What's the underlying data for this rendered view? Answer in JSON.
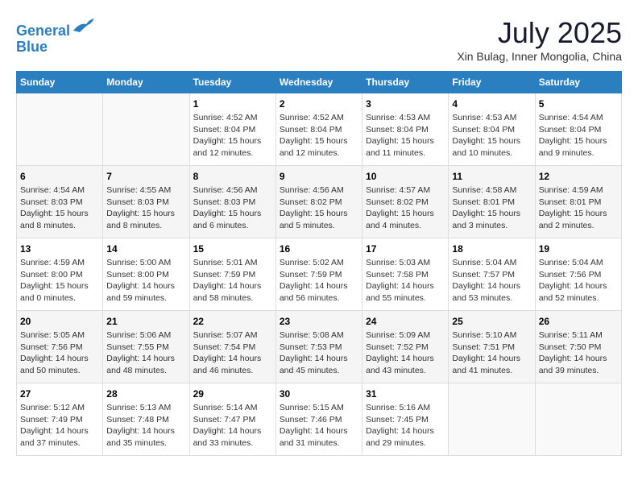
{
  "header": {
    "logo_line1": "General",
    "logo_line2": "Blue",
    "month_title": "July 2025",
    "location": "Xin Bulag, Inner Mongolia, China"
  },
  "weekdays": [
    "Sunday",
    "Monday",
    "Tuesday",
    "Wednesday",
    "Thursday",
    "Friday",
    "Saturday"
  ],
  "weeks": [
    [
      {
        "day": "",
        "sunrise": "",
        "sunset": "",
        "daylight": ""
      },
      {
        "day": "",
        "sunrise": "",
        "sunset": "",
        "daylight": ""
      },
      {
        "day": "1",
        "sunrise": "Sunrise: 4:52 AM",
        "sunset": "Sunset: 8:04 PM",
        "daylight": "Daylight: 15 hours and 12 minutes."
      },
      {
        "day": "2",
        "sunrise": "Sunrise: 4:52 AM",
        "sunset": "Sunset: 8:04 PM",
        "daylight": "Daylight: 15 hours and 12 minutes."
      },
      {
        "day": "3",
        "sunrise": "Sunrise: 4:53 AM",
        "sunset": "Sunset: 8:04 PM",
        "daylight": "Daylight: 15 hours and 11 minutes."
      },
      {
        "day": "4",
        "sunrise": "Sunrise: 4:53 AM",
        "sunset": "Sunset: 8:04 PM",
        "daylight": "Daylight: 15 hours and 10 minutes."
      },
      {
        "day": "5",
        "sunrise": "Sunrise: 4:54 AM",
        "sunset": "Sunset: 8:04 PM",
        "daylight": "Daylight: 15 hours and 9 minutes."
      }
    ],
    [
      {
        "day": "6",
        "sunrise": "Sunrise: 4:54 AM",
        "sunset": "Sunset: 8:03 PM",
        "daylight": "Daylight: 15 hours and 8 minutes."
      },
      {
        "day": "7",
        "sunrise": "Sunrise: 4:55 AM",
        "sunset": "Sunset: 8:03 PM",
        "daylight": "Daylight: 15 hours and 8 minutes."
      },
      {
        "day": "8",
        "sunrise": "Sunrise: 4:56 AM",
        "sunset": "Sunset: 8:03 PM",
        "daylight": "Daylight: 15 hours and 6 minutes."
      },
      {
        "day": "9",
        "sunrise": "Sunrise: 4:56 AM",
        "sunset": "Sunset: 8:02 PM",
        "daylight": "Daylight: 15 hours and 5 minutes."
      },
      {
        "day": "10",
        "sunrise": "Sunrise: 4:57 AM",
        "sunset": "Sunset: 8:02 PM",
        "daylight": "Daylight: 15 hours and 4 minutes."
      },
      {
        "day": "11",
        "sunrise": "Sunrise: 4:58 AM",
        "sunset": "Sunset: 8:01 PM",
        "daylight": "Daylight: 15 hours and 3 minutes."
      },
      {
        "day": "12",
        "sunrise": "Sunrise: 4:59 AM",
        "sunset": "Sunset: 8:01 PM",
        "daylight": "Daylight: 15 hours and 2 minutes."
      }
    ],
    [
      {
        "day": "13",
        "sunrise": "Sunrise: 4:59 AM",
        "sunset": "Sunset: 8:00 PM",
        "daylight": "Daylight: 15 hours and 0 minutes."
      },
      {
        "day": "14",
        "sunrise": "Sunrise: 5:00 AM",
        "sunset": "Sunset: 8:00 PM",
        "daylight": "Daylight: 14 hours and 59 minutes."
      },
      {
        "day": "15",
        "sunrise": "Sunrise: 5:01 AM",
        "sunset": "Sunset: 7:59 PM",
        "daylight": "Daylight: 14 hours and 58 minutes."
      },
      {
        "day": "16",
        "sunrise": "Sunrise: 5:02 AM",
        "sunset": "Sunset: 7:59 PM",
        "daylight": "Daylight: 14 hours and 56 minutes."
      },
      {
        "day": "17",
        "sunrise": "Sunrise: 5:03 AM",
        "sunset": "Sunset: 7:58 PM",
        "daylight": "Daylight: 14 hours and 55 minutes."
      },
      {
        "day": "18",
        "sunrise": "Sunrise: 5:04 AM",
        "sunset": "Sunset: 7:57 PM",
        "daylight": "Daylight: 14 hours and 53 minutes."
      },
      {
        "day": "19",
        "sunrise": "Sunrise: 5:04 AM",
        "sunset": "Sunset: 7:56 PM",
        "daylight": "Daylight: 14 hours and 52 minutes."
      }
    ],
    [
      {
        "day": "20",
        "sunrise": "Sunrise: 5:05 AM",
        "sunset": "Sunset: 7:56 PM",
        "daylight": "Daylight: 14 hours and 50 minutes."
      },
      {
        "day": "21",
        "sunrise": "Sunrise: 5:06 AM",
        "sunset": "Sunset: 7:55 PM",
        "daylight": "Daylight: 14 hours and 48 minutes."
      },
      {
        "day": "22",
        "sunrise": "Sunrise: 5:07 AM",
        "sunset": "Sunset: 7:54 PM",
        "daylight": "Daylight: 14 hours and 46 minutes."
      },
      {
        "day": "23",
        "sunrise": "Sunrise: 5:08 AM",
        "sunset": "Sunset: 7:53 PM",
        "daylight": "Daylight: 14 hours and 45 minutes."
      },
      {
        "day": "24",
        "sunrise": "Sunrise: 5:09 AM",
        "sunset": "Sunset: 7:52 PM",
        "daylight": "Daylight: 14 hours and 43 minutes."
      },
      {
        "day": "25",
        "sunrise": "Sunrise: 5:10 AM",
        "sunset": "Sunset: 7:51 PM",
        "daylight": "Daylight: 14 hours and 41 minutes."
      },
      {
        "day": "26",
        "sunrise": "Sunrise: 5:11 AM",
        "sunset": "Sunset: 7:50 PM",
        "daylight": "Daylight: 14 hours and 39 minutes."
      }
    ],
    [
      {
        "day": "27",
        "sunrise": "Sunrise: 5:12 AM",
        "sunset": "Sunset: 7:49 PM",
        "daylight": "Daylight: 14 hours and 37 minutes."
      },
      {
        "day": "28",
        "sunrise": "Sunrise: 5:13 AM",
        "sunset": "Sunset: 7:48 PM",
        "daylight": "Daylight: 14 hours and 35 minutes."
      },
      {
        "day": "29",
        "sunrise": "Sunrise: 5:14 AM",
        "sunset": "Sunset: 7:47 PM",
        "daylight": "Daylight: 14 hours and 33 minutes."
      },
      {
        "day": "30",
        "sunrise": "Sunrise: 5:15 AM",
        "sunset": "Sunset: 7:46 PM",
        "daylight": "Daylight: 14 hours and 31 minutes."
      },
      {
        "day": "31",
        "sunrise": "Sunrise: 5:16 AM",
        "sunset": "Sunset: 7:45 PM",
        "daylight": "Daylight: 14 hours and 29 minutes."
      },
      {
        "day": "",
        "sunrise": "",
        "sunset": "",
        "daylight": ""
      },
      {
        "day": "",
        "sunrise": "",
        "sunset": "",
        "daylight": ""
      }
    ]
  ]
}
